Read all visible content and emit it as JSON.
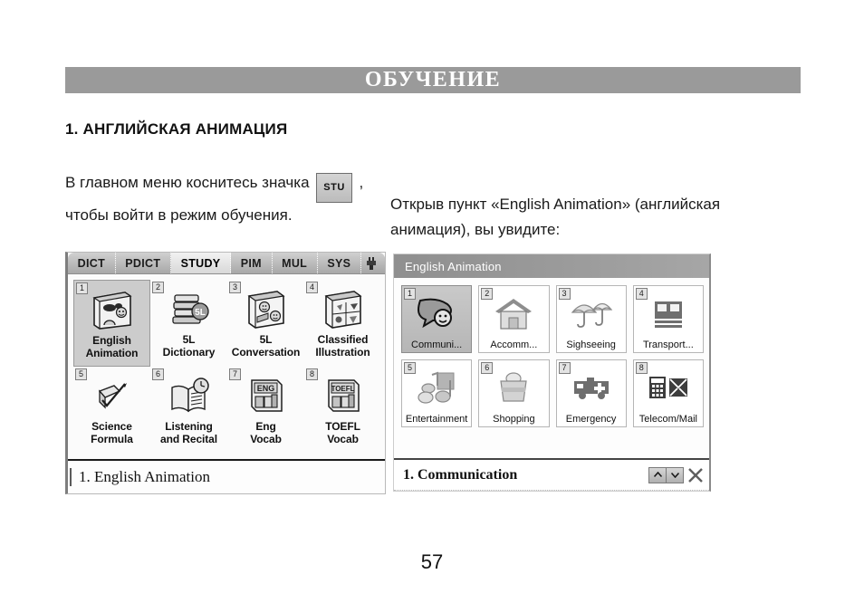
{
  "header": {
    "title": "ОБУЧЕНИЕ"
  },
  "section": {
    "heading": "1. АНГЛИЙСКАЯ АНИМАЦИЯ"
  },
  "body": {
    "left_before": "В главном меню коснитесь значка",
    "left_chip": "STU",
    "left_after": ", чтобы войти в режим обучения.",
    "right": "Открыв пункт «English Animation» (английская анимация), вы увидите:"
  },
  "device_left": {
    "tabs": [
      {
        "label": "DICT",
        "selected": false
      },
      {
        "label": "PDICT",
        "selected": false
      },
      {
        "label": "STUDY",
        "selected": true
      },
      {
        "label": "PIM",
        "selected": false
      },
      {
        "label": "MUL",
        "selected": false
      },
      {
        "label": "SYS",
        "selected": false
      }
    ],
    "tab_icon": "plug-icon",
    "items": [
      {
        "num": "1",
        "label": "English\nAnimation",
        "line1": "English",
        "line2": "Animation",
        "icon": "animation-book-icon",
        "selected": true
      },
      {
        "num": "2",
        "label": "5L Dictionary",
        "line1": "5L",
        "line2": "Dictionary",
        "icon": "books-5l-icon",
        "selected": false
      },
      {
        "num": "3",
        "label": "5L Conversation",
        "line1": "5L",
        "line2": "Conversation",
        "icon": "conversation-book-icon",
        "selected": false
      },
      {
        "num": "4",
        "label": "Classified Illustration",
        "line1": "Classified",
        "line2": "Illustration",
        "icon": "classified-book-icon",
        "selected": false
      },
      {
        "num": "5",
        "label": "Science Formula",
        "line1": "Science",
        "line2": "Formula",
        "icon": "science-formula-icon",
        "selected": false
      },
      {
        "num": "6",
        "label": "Listening and Recital",
        "line1": "Listening",
        "line2": "and  Recital",
        "icon": "listening-book-clock-icon",
        "selected": false
      },
      {
        "num": "7",
        "label": "Eng Vocab",
        "line1": "Eng",
        "line2": "Vocab",
        "icon": "eng-vocab-icon",
        "badge": "ENG",
        "selected": false
      },
      {
        "num": "8",
        "label": "TOEFL Vocab",
        "line1": "TOEFL",
        "line2": "Vocab",
        "icon": "toefl-vocab-icon",
        "badge": "TOEFL",
        "selected": false
      }
    ],
    "status": "1. English  Animation"
  },
  "device_right": {
    "title": "English Animation",
    "items": [
      {
        "num": "1",
        "label": "Communi...",
        "icon": "speech-bubble-smiley-icon",
        "selected": true
      },
      {
        "num": "2",
        "label": "Accomm...",
        "icon": "house-icon",
        "selected": false
      },
      {
        "num": "3",
        "label": "Sighseeing",
        "icon": "umbrellas-icon",
        "selected": false
      },
      {
        "num": "4",
        "label": "Transport...",
        "icon": "train-icon",
        "selected": false
      },
      {
        "num": "5",
        "label": "Entertainment",
        "icon": "music-notes-icon",
        "selected": false
      },
      {
        "num": "6",
        "label": "Shopping",
        "icon": "shopping-basket-icon",
        "selected": false
      },
      {
        "num": "7",
        "label": "Emergency",
        "icon": "ambulance-icon",
        "selected": false
      },
      {
        "num": "8",
        "label": "Telecom/Mail",
        "icon": "phone-mail-icon",
        "selected": false
      }
    ],
    "status": "1. Communication",
    "nav": {
      "up": "▲",
      "down": "▼",
      "close": "close-icon"
    }
  },
  "footer": {
    "page_number": "57"
  },
  "colors": {
    "header_bar": "#9a9a9a",
    "selected_cell": "#cccccc",
    "titlebar": "#9c9c9c",
    "text": "#111111"
  }
}
